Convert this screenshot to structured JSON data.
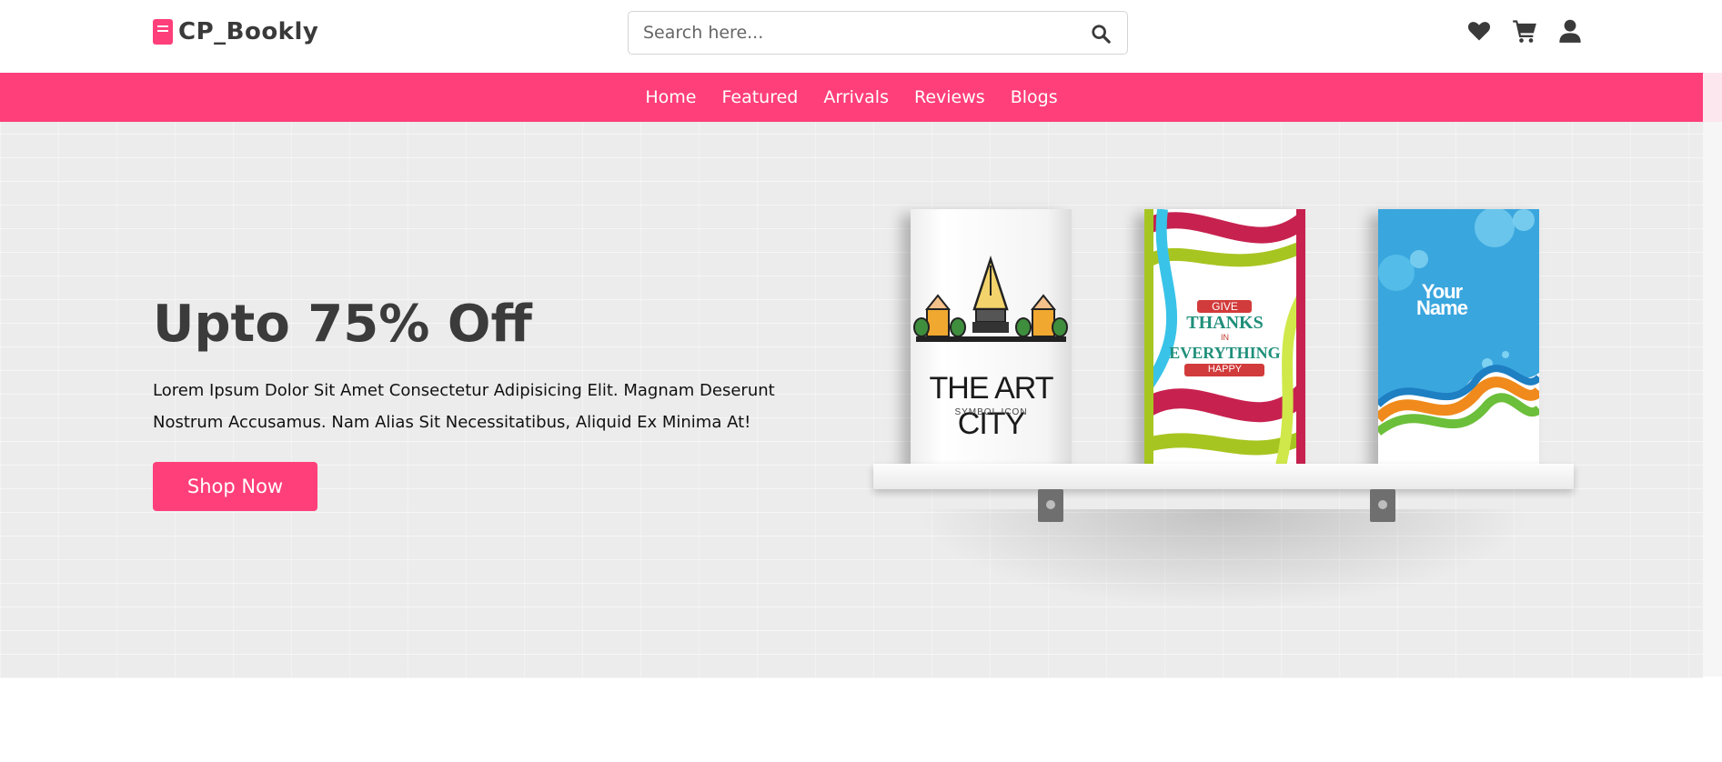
{
  "brand": {
    "name": "CP_Bookly",
    "accent": "#ff3f7a"
  },
  "search": {
    "placeholder": "Search here..."
  },
  "header_icons": [
    "heart-icon",
    "cart-icon",
    "user-icon"
  ],
  "nav": {
    "items": [
      {
        "label": "Home"
      },
      {
        "label": "Featured"
      },
      {
        "label": "Arrivals"
      },
      {
        "label": "Reviews"
      },
      {
        "label": "Blogs"
      }
    ]
  },
  "hero": {
    "title": "Upto 75% Off",
    "description": "Lorem Ipsum Dolor Sit Amet Consectetur Adipisicing Elit. Magnam Deserunt Nostrum Accusamus. Nam Alias Sit Necessitatibus, Aliquid Ex Minima At!",
    "button_label": "Shop Now"
  },
  "books": [
    {
      "title": "THE ART CITY",
      "subtitle": "SYMBOL ICON"
    },
    {
      "line1": "GIVE",
      "line2": "THANKS",
      "line3": "IN",
      "line4": "EVERYTHING",
      "line5": "HAPPY"
    },
    {
      "title": "Your Name"
    }
  ]
}
